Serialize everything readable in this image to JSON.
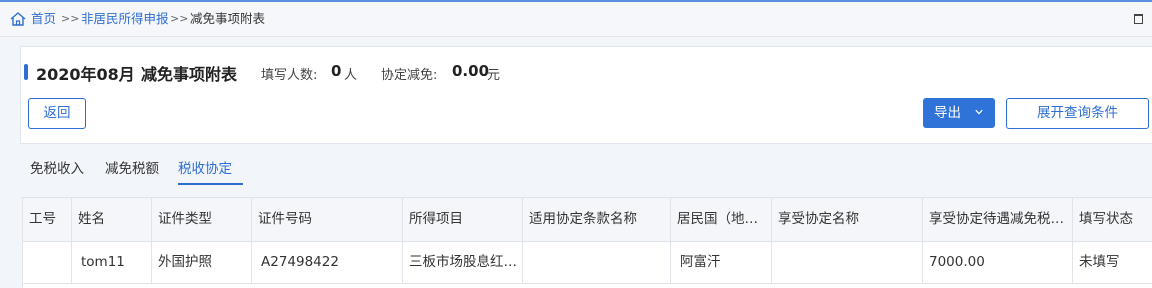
{
  "breadcrumb": {
    "home": "首页",
    "sep1": ">>",
    "section": "非居民所得申报",
    "sep2": ">>",
    "current": "减免事项附表"
  },
  "header": {
    "period": "2020年08月",
    "title": "减免事项附表",
    "filled_count_label": "填写人数:",
    "filled_count": "0",
    "filled_count_unit": "人",
    "treaty_relief_label": "协定减免:",
    "treaty_relief": "0.00",
    "treaty_relief_unit": "元"
  },
  "buttons": {
    "back": "返回",
    "export": "导出",
    "expand_query": "展开查询条件"
  },
  "tabs": [
    {
      "label": "免税收入",
      "active": false
    },
    {
      "label": "减免税额",
      "active": false
    },
    {
      "label": "税收协定",
      "active": true
    }
  ],
  "table": {
    "columns": [
      "工号",
      "姓名",
      "证件类型",
      "证件号码",
      "所得项目",
      "适用协定条款名称",
      "居民国（地…",
      "享受协定名称",
      "享受协定待遇减免税…",
      "填写状态"
    ],
    "rows": [
      [
        "",
        "tom11",
        "外国护照",
        "A27498422",
        "三板市场股息红…",
        "",
        "阿富汗",
        "",
        "7000.00",
        "未填写"
      ]
    ]
  },
  "colors": {
    "accent": "#2f6fd1",
    "export_button": "#2f73d8",
    "page_background": "#f2f5fa"
  }
}
